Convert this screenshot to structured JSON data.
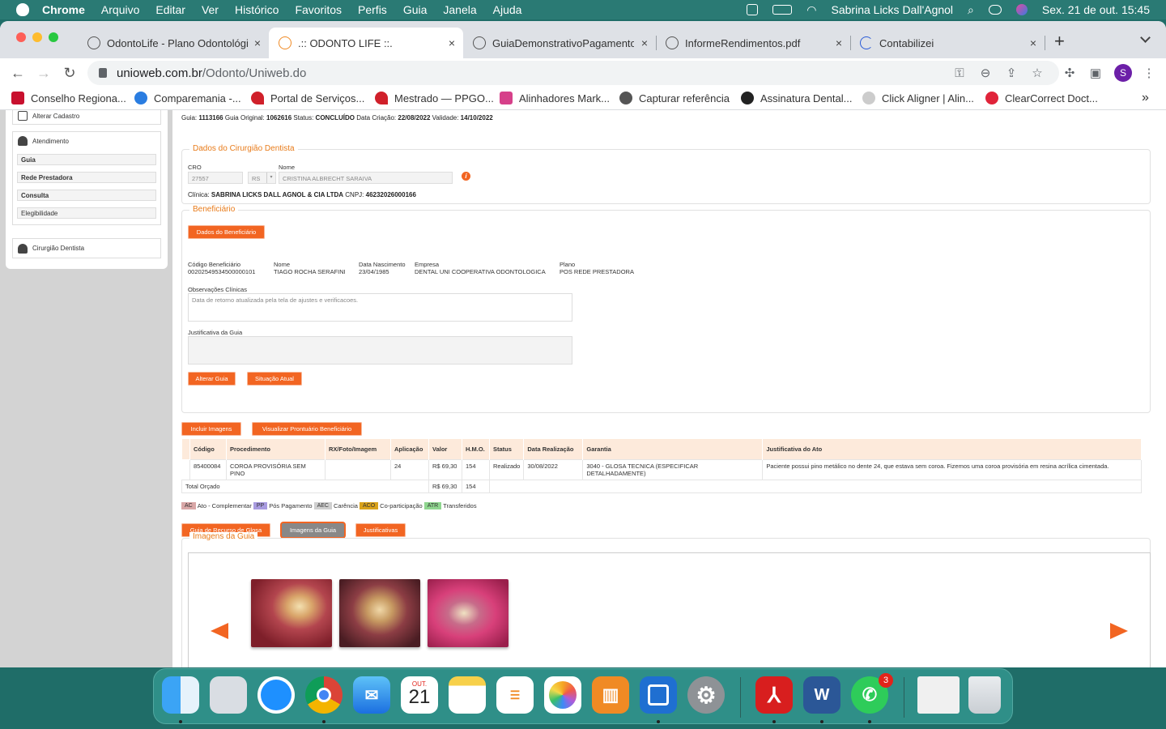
{
  "menubar": {
    "app": "Chrome",
    "items": [
      "Arquivo",
      "Editar",
      "Ver",
      "Histórico",
      "Favoritos",
      "Perfis",
      "Guia",
      "Janela",
      "Ajuda"
    ],
    "user": "Sabrina Licks Dall'Agnol",
    "datetime": "Sex. 21 de out.  15:45"
  },
  "tabs": [
    {
      "label": "OdontoLife - Plano Odontológico",
      "close": "×"
    },
    {
      "label": ".:: ODONTO LIFE ::.",
      "close": "×"
    },
    {
      "label": "GuiaDemonstrativoPagamento...",
      "close": "×"
    },
    {
      "label": "InformeRendimentos.pdf",
      "close": "×"
    },
    {
      "label": "Contabilizei",
      "close": "×"
    }
  ],
  "new_tab": "+",
  "omnibox": {
    "domain": "unioweb.com.br",
    "path": "/Odonto/Uniweb.do"
  },
  "profile_initial": "S",
  "bookmarks": [
    {
      "label": "Conselho Regiona...",
      "color": "#c8102e"
    },
    {
      "label": "Comparemania -...",
      "color": "#2a7de1"
    },
    {
      "label": "Portal de Serviços...",
      "color": "#d0202a"
    },
    {
      "label": "Mestrado — PPGO...",
      "color": "#d0202a"
    },
    {
      "label": "Alinhadores Mark...",
      "color": "#d6408a"
    },
    {
      "label": "Capturar referência",
      "color": "#555555"
    },
    {
      "label": "Assinatura Dental...",
      "color": "#222222"
    },
    {
      "label": "Click Aligner | Alin...",
      "color": "#cccccc"
    },
    {
      "label": "ClearCorrect Doct...",
      "color": "#e0243a"
    }
  ],
  "bookmarks_more": "»",
  "sidebar": {
    "alterar_cadastro": "Alterar Cadastro",
    "atendimento": "Atendimento",
    "items": [
      "Guia",
      "Rede Prestadora",
      "Consulta",
      "Elegibilidade"
    ],
    "cirurgiao": "Cirurgião Dentista"
  },
  "guia_header": {
    "guia_label": "Guia:",
    "guia": "1113166",
    "orig_label": "Guia Original:",
    "orig": "1062616",
    "status_label": "Status:",
    "status": "CONCLUÍDO",
    "criacao_label": "Data Criação:",
    "criacao": "22/08/2022",
    "validade_label": "Validade:",
    "validade": "14/10/2022"
  },
  "dentista": {
    "legend": "Dados do Cirurgião Dentista",
    "cro_label": "CRO",
    "cro": "27557",
    "uf": "RS",
    "nome_label": "Nome",
    "nome": "CRISTINA ALBRECHT SARAIVA",
    "clinica_label": "Clínica:",
    "clinica": "SABRINA LICKS DALL AGNOL & CIA LTDA",
    "cnpj_label": "CNPJ:",
    "cnpj": "46232026000166",
    "info": "i"
  },
  "beneficiario": {
    "legend": "Beneficiário",
    "btn": "Dados do Beneficiário",
    "codigo_label": "Código Beneficiário",
    "codigo": "00202549534500000101",
    "nome_label": "Nome",
    "nome": "TIAGO ROCHA SERAFINI",
    "nasc_label": "Data Nascimento",
    "nasc": "23/04/1985",
    "empresa_label": "Empresa",
    "empresa": "DENTAL UNI COOPERATIVA ODONTOLOGICA",
    "plano_label": "Plano",
    "plano": "POS REDE PRESTADORA",
    "obs_label": "Observações Clínicas",
    "obs": "Data de retorno atualizada pela tela de ajustes e verificacoes.",
    "just_label": "Justificativa da Guia",
    "btn_alterar": "Alterar Guia",
    "btn_situacao": "Situação Atual"
  },
  "actions": {
    "incluir": "Incluir Imagens",
    "prontuario": "Visualizar Prontuário Beneficiário"
  },
  "table": {
    "headers": [
      "Código",
      "Procedimento",
      "RX/Foto/Imagem",
      "Aplicação",
      "Valor",
      "H.M.O.",
      "Status",
      "Data Realização",
      "Garantia",
      "Justificativa do Ato"
    ],
    "row": [
      "85400084",
      "COROA PROVISÓRIA SEM PINO",
      "",
      "24",
      "R$ 69,30",
      "154",
      "Realizado",
      "30/08/2022",
      "3040 - GLOSA TECNICA (ESPECIFICAR DETALHADAMENTE)",
      "Paciente possui pino metálico no dente 24, que estava sem coroa. Fizemos uma coroa provisória em resina acrílica cimentada."
    ],
    "total_label": "Total Orçado",
    "total_valor": "R$ 69,30",
    "total_hmo": "154"
  },
  "legend_items": [
    {
      "code": "AC",
      "label": "Ato - Complementar",
      "color": "#d9a7a7"
    },
    {
      "code": "PP",
      "label": "Pós Pagamento",
      "color": "#a89be0"
    },
    {
      "code": "AEC",
      "label": "Carência",
      "color": "#cfcfcf"
    },
    {
      "code": "ACO",
      "label": "Co-participação",
      "color": "#d9a21b"
    },
    {
      "code": "ATR",
      "label": "Transferidos",
      "color": "#8fd68f"
    }
  ],
  "bottom_tabs": {
    "glosa": "Guia de Recurso de Glosa",
    "imagens": "Imagens da Guia",
    "justificativas": "Justificativas"
  },
  "imagens_legend": "Imagens da Guia",
  "dock": {
    "calendar_month": "OUT.",
    "calendar_day": "21",
    "whatsapp_badge": "3",
    "word": "W"
  }
}
